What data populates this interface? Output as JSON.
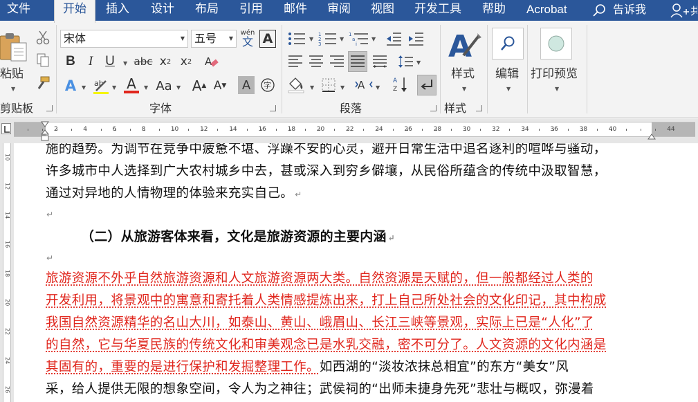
{
  "tabs": [
    {
      "label": "文件",
      "active": false
    },
    {
      "label": "开始",
      "active": true
    },
    {
      "label": "插入",
      "active": false
    },
    {
      "label": "设计",
      "active": false
    },
    {
      "label": "布局",
      "active": false
    },
    {
      "label": "引用",
      "active": false
    },
    {
      "label": "邮件",
      "active": false
    },
    {
      "label": "审阅",
      "active": false
    },
    {
      "label": "视图",
      "active": false
    },
    {
      "label": "开发工具",
      "active": false
    },
    {
      "label": "帮助",
      "active": false
    },
    {
      "label": "Acrobat",
      "active": false
    }
  ],
  "tell_me": {
    "label": "告诉我"
  },
  "ribbon": {
    "clipboard": {
      "paste_label": "粘贴",
      "group_label": "剪贴板"
    },
    "font": {
      "font_name": "宋体",
      "font_size": "五号",
      "group_label": "字体",
      "phonetic_top": "wén",
      "phonetic_bottom": "文"
    },
    "paragraph": {
      "group_label": "段落"
    },
    "styles": {
      "styles_label": "样式",
      "group_label": "样式"
    },
    "editing": {
      "label": "编辑"
    },
    "print_preview": {
      "label": "打印预览"
    }
  },
  "ruler": {
    "ticks": [
      "2",
      "4",
      "6",
      "8",
      "10",
      "12",
      "14",
      "16",
      "18",
      "20",
      "22",
      "24",
      "26",
      "28",
      "30",
      "32",
      "34",
      "36",
      "38",
      "40",
      "44"
    ]
  },
  "vruler": {
    "ticks": [
      "10",
      "12",
      "14",
      "16",
      "18",
      "20",
      "22",
      "24",
      "26"
    ]
  },
  "document": {
    "lines": [
      {
        "text": "施的趋势。为调节在竞争中疲惫不堪、浮躁不安的心灵，避开日常生活中追名逐利的喧哗与骚动，",
        "style": "normal",
        "para_end": false
      },
      {
        "text": "许多城市中人选择到广大农村城乡中去，甚或深入到穷乡僻壤，从民俗所蕴含的传统中汲取智慧，",
        "style": "normal",
        "para_end": false
      },
      {
        "text": "通过对异地的人情物理的体验来充实自己。",
        "style": "normal",
        "para_end": true
      }
    ],
    "heading": "（二）从旅游客体来看，文化是旅游资源的主要内涵",
    "red_lines": [
      "旅游资源不外乎自然旅游资源和人文旅游资源两大类。自然资源是天赋的，但一般都经过人类的",
      "开发利用，将景观中的寓意和寄托着人类情感提炼出来，打上自己所处社会的文化印记，其中构成",
      "我国自然资源精华的名山大川，如泰山、黄山、峨眉山、长江三峡等景观，实际上已是“人化”了",
      "的自然，它与华夏民族的传统文化和审美观念已是水乳交融，密不可分了。人文资源的文化内涵是"
    ],
    "mixed_line": {
      "red": "其固有的，重要的是进行保护和发掘整理工作。",
      "black": "如西湖的“淡妆浓抹总相宜”的东方“美女”风"
    },
    "last_line": "采，给人提供无限的想象空间，令人为之神往；武侯祠的“出师未捷身先死”悲壮与概叹，弥漫着",
    "para_mark": "↵"
  },
  "colors": {
    "tabbar": "#2b579a",
    "ribbon": "#f3f3f3",
    "red_text": "#e0261d"
  }
}
